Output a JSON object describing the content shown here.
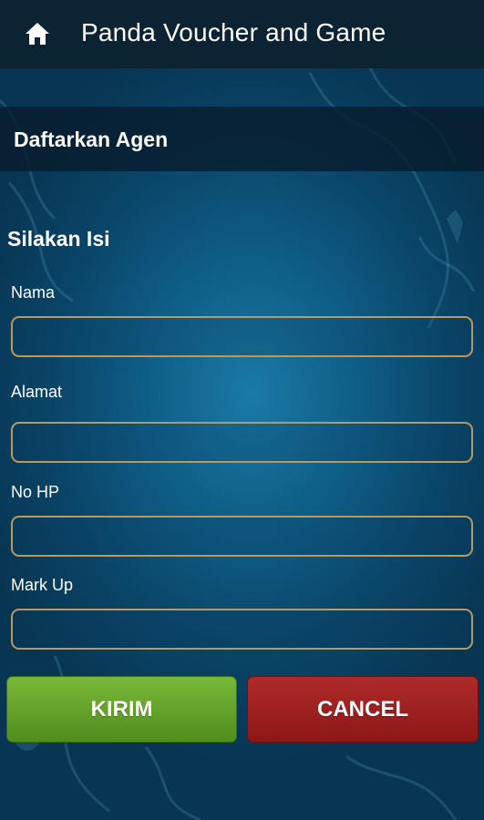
{
  "appbar": {
    "title": "Panda Voucher and Game",
    "home_icon": "home-icon"
  },
  "section": {
    "title": "Daftarkan Agen"
  },
  "form": {
    "heading": "Silakan Isi",
    "fields": [
      {
        "label": "Nama",
        "value": "",
        "placeholder": ""
      },
      {
        "label": "Alamat",
        "value": "",
        "placeholder": ""
      },
      {
        "label": "No HP",
        "value": "",
        "placeholder": ""
      },
      {
        "label": "Mark Up",
        "value": "",
        "placeholder": ""
      }
    ]
  },
  "buttons": {
    "submit_label": "KIRIM",
    "cancel_label": "CANCEL"
  },
  "colors": {
    "appbar_bg": "#0c2333",
    "background": "#0f5f88",
    "input_border": "#b89a5e",
    "submit_button": "#6aa62e",
    "cancel_button": "#9e2020"
  }
}
